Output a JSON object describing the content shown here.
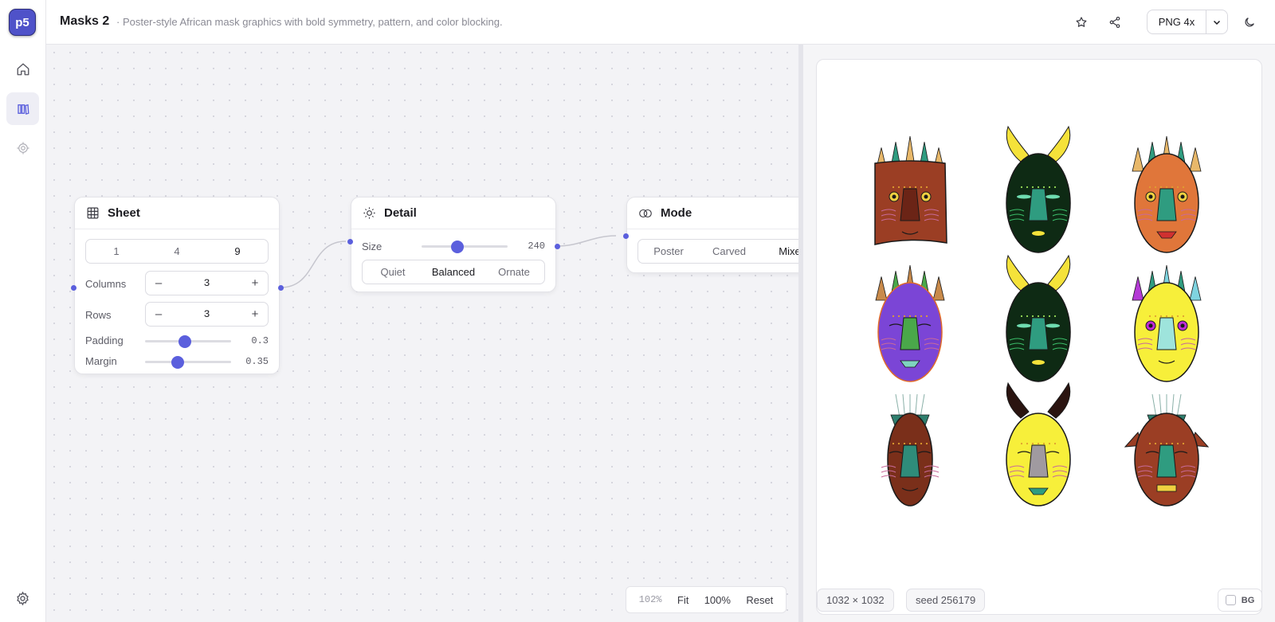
{
  "app": {
    "logo": "p5",
    "title": "Masks 2",
    "subtitle": "· Poster-style African mask graphics with bold symmetry, pattern, and color blocking."
  },
  "rail": {
    "items": [
      "home-icon",
      "library-icon",
      "target-icon"
    ],
    "active": "library-icon",
    "bottom": "gear-icon"
  },
  "header": {
    "export_label": "PNG 4x",
    "icons": [
      "star-icon",
      "share-icon",
      "chevron-down-icon",
      "moon-icon"
    ]
  },
  "nodes": {
    "sheet": {
      "title": "Sheet",
      "presets": [
        "1",
        "4",
        "9"
      ],
      "selected_preset": "9",
      "columns_label": "Columns",
      "columns": "3",
      "rows_label": "Rows",
      "rows": "3",
      "padding_label": "Padding",
      "padding": "0.3",
      "padding_fraction": 0.46,
      "margin_label": "Margin",
      "margin": "0.35",
      "margin_fraction": 0.38,
      "minus": "–",
      "plus": "+"
    },
    "detail": {
      "title": "Detail",
      "size_label": "Size",
      "size": "240",
      "size_fraction": 0.42,
      "levels": [
        "Quiet",
        "Balanced",
        "Ornate"
      ],
      "selected_level": "Balanced"
    },
    "mode": {
      "title": "Mode",
      "options": [
        "Poster",
        "Carved",
        "Mixe"
      ],
      "selected": "Mixe"
    }
  },
  "zoom": {
    "level": "102%",
    "fit": "Fit",
    "hundred": "100%",
    "reset": "Reset"
  },
  "preview": {
    "dimensions": "1032 × 1032",
    "seed": "seed 256179",
    "bg_label": "BG",
    "masks": [
      {
        "row": 0,
        "col": 0,
        "face": "#9b3e24",
        "crown": "spikes"
      },
      {
        "row": 0,
        "col": 1,
        "face": "#0e2a14",
        "crown": "horns"
      },
      {
        "row": 0,
        "col": 2,
        "face": "#e0763a",
        "crown": "spikes"
      },
      {
        "row": 1,
        "col": 0,
        "face": "#7b45d6",
        "crown": "spikes"
      },
      {
        "row": 1,
        "col": 1,
        "face": "#0e2a14",
        "crown": "horns"
      },
      {
        "row": 1,
        "col": 2,
        "face": "#f7ef3a",
        "crown": "spikes"
      },
      {
        "row": 2,
        "col": 0,
        "face": "#7a2f1a",
        "crown": "fan"
      },
      {
        "row": 2,
        "col": 1,
        "face": "#f7ef3a",
        "crown": "horns"
      },
      {
        "row": 2,
        "col": 2,
        "face": "#9b3e24",
        "crown": "fan"
      }
    ]
  }
}
